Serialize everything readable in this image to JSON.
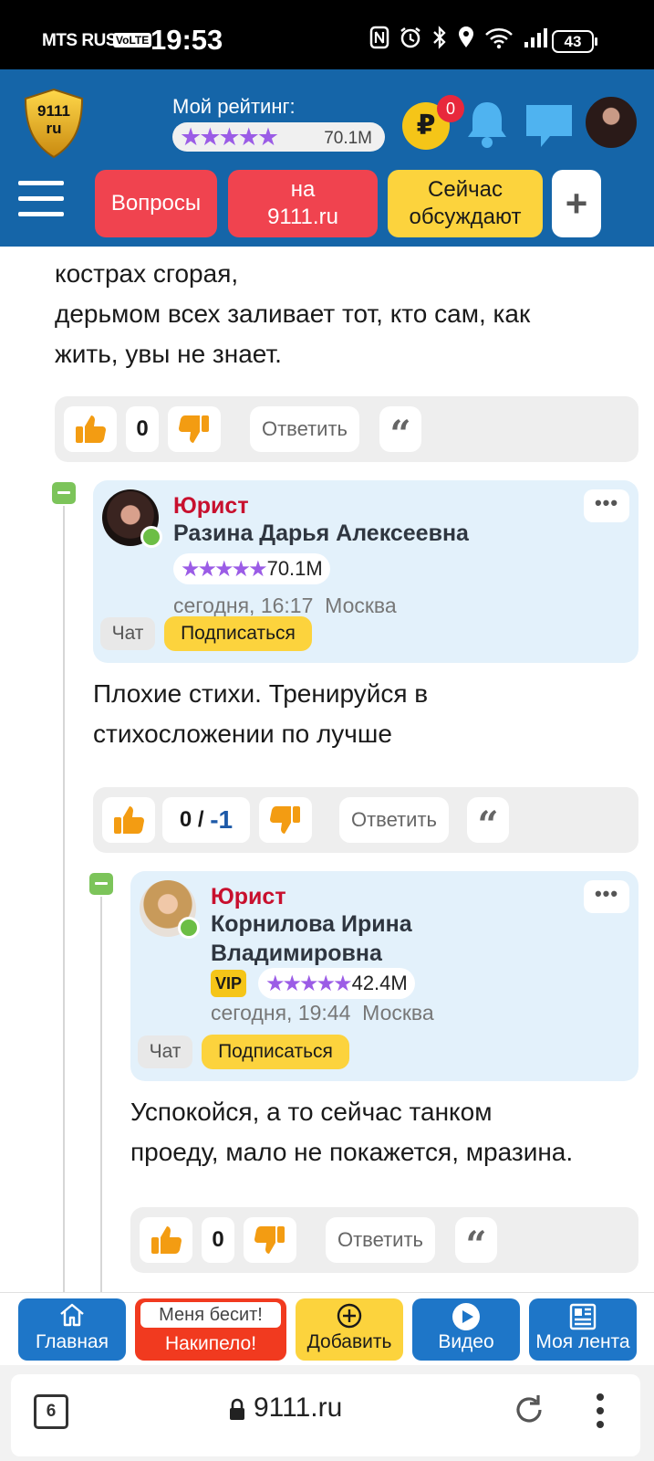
{
  "status": {
    "carrier": "MTS RUS",
    "volte": "VoLTE",
    "time": "19:53",
    "battery": "43"
  },
  "header": {
    "logo_text_1": "9111",
    "logo_text_2": "ru",
    "rating_title": "Мой рейтинг:",
    "rating_stars": "★★★★★",
    "rating_value": "70.1M",
    "coin_symbol": "₽",
    "coin_badge": "0",
    "nav_buttons": [
      "Вопросы",
      "на 9111.ru",
      "Сейчас обсуждают"
    ],
    "plus": "+"
  },
  "post_top": {
    "text_line_1": "кострах сгорая,",
    "text_line_2": "дерьмом всех заливает тот, кто сам, как",
    "text_line_3": "жить, увы не знает.",
    "count": "0",
    "reply": "Ответить",
    "quote": "“"
  },
  "comment1": {
    "role": "Юрист",
    "name": "Разина Дарья Алексеевна",
    "stars": "★★★★★",
    "rating": "70.1M",
    "time": "сегодня, 16:17",
    "city": "Москва",
    "chat": "Чат",
    "subscribe": "Подписаться",
    "more": "•••",
    "text_line_1": "Плохие стихи. Тренируйся в",
    "text_line_2": "стихосложении по лучше",
    "count_a": "0 /",
    "count_b": "-1",
    "reply": "Ответить",
    "quote": "“"
  },
  "comment2": {
    "role": "Юрист",
    "name_line_1": "Корнилова Ирина",
    "name_line_2": "Владимировна",
    "vip": "VIP",
    "stars": "★★★★★",
    "rating": "42.4M",
    "time": "сегодня, 19:44",
    "city": "Москва",
    "chat": "Чат",
    "subscribe": "Подписаться",
    "more": "•••",
    "text_line_1": "Успокойся, а то сейчас танком",
    "text_line_2": "проеду, мало не покажется, мразина.",
    "count": "0",
    "reply": "Ответить",
    "quote": "“"
  },
  "bottom_nav": {
    "home": "Главная",
    "rant_top": "Меня бесит!",
    "rant_bottom": "Накипело!",
    "add": "Добавить",
    "video": "Видео",
    "feed": "Моя лента"
  },
  "browser": {
    "tabs": "6",
    "url": "9111.ru"
  },
  "colors": {
    "header_blue": "#1565a8",
    "red": "#f0434f",
    "yellow": "#fcd33d",
    "card_blue": "#e3f1fb",
    "role_red": "#c8102e",
    "star_purple": "#9b5ce6",
    "online_green": "#6cbe45"
  }
}
